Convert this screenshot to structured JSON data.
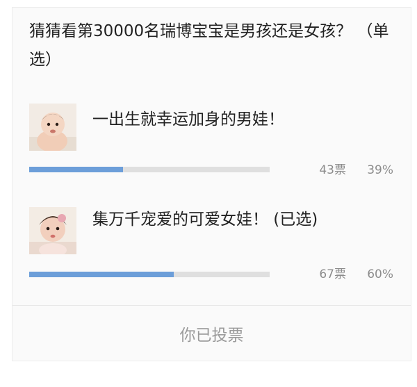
{
  "poll": {
    "question": "猜猜看第30000名瑞博宝宝是男孩还是女孩？ （单选）",
    "options": [
      {
        "label": "一出生就幸运加身的男娃！",
        "votes": "43票",
        "percent": "39%",
        "fill_fraction": 0.39,
        "image_icon": "baby-boy-photo"
      },
      {
        "label": "集万千宠爱的可爱女娃！ (已选)",
        "votes": "67票",
        "percent": "60%",
        "fill_fraction": 0.6,
        "image_icon": "baby-girl-photo"
      }
    ],
    "status_label": "你已投票"
  },
  "colors": {
    "bar_fill": "#6c9ed9",
    "bar_track": "#dfdfdf",
    "text": "#222222",
    "muted": "#8c8c8c"
  }
}
